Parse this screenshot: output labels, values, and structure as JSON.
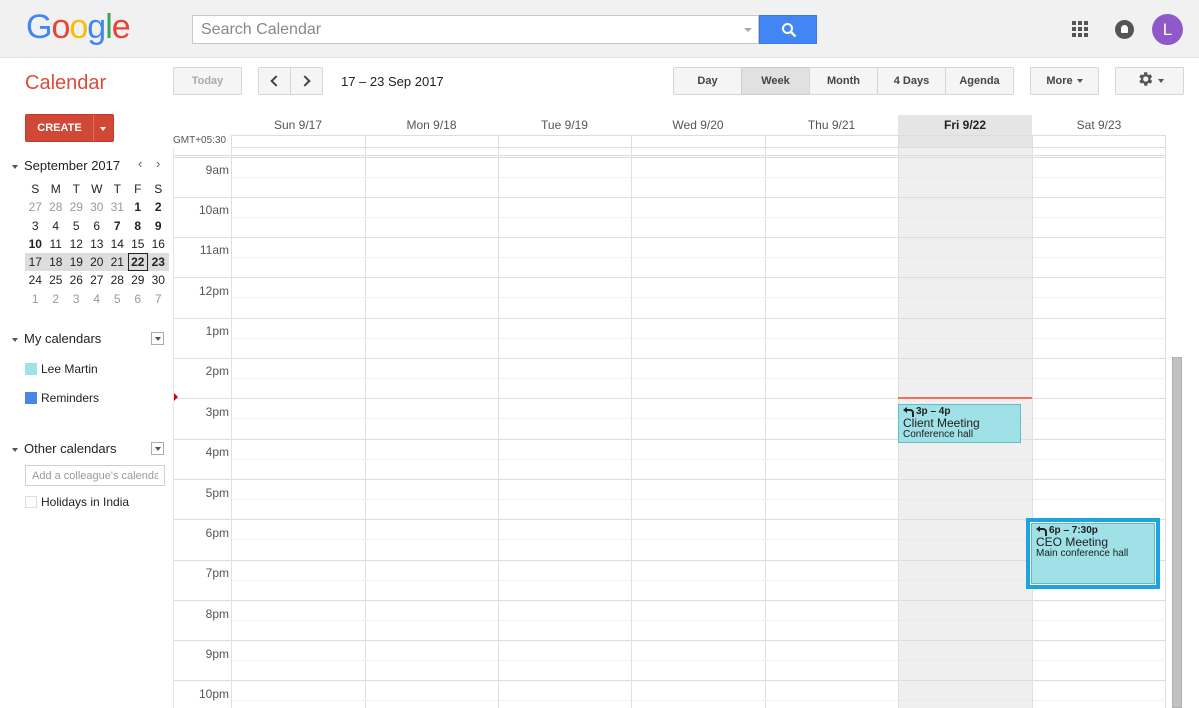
{
  "header": {
    "logo_text": "Google",
    "search_placeholder": "Search Calendar",
    "avatar_initial": "L"
  },
  "toolbar": {
    "app_name": "Calendar",
    "today_label": "Today",
    "date_range": "17 – 23 Sep 2017",
    "views": [
      "Day",
      "Week",
      "Month",
      "4 Days",
      "Agenda"
    ],
    "active_view": "Week",
    "more_label": "More"
  },
  "sidebar": {
    "create_label": "CREATE",
    "mini_calendar": {
      "title": "September 2017",
      "weekdays": [
        "S",
        "M",
        "T",
        "W",
        "T",
        "F",
        "S"
      ],
      "weeks": [
        [
          "27",
          "28",
          "29",
          "30",
          "31",
          "1",
          "2"
        ],
        [
          "3",
          "4",
          "5",
          "6",
          "7",
          "8",
          "9"
        ],
        [
          "10",
          "11",
          "12",
          "13",
          "14",
          "15",
          "16"
        ],
        [
          "17",
          "18",
          "19",
          "20",
          "21",
          "22",
          "23"
        ],
        [
          "24",
          "25",
          "26",
          "27",
          "28",
          "29",
          "30"
        ],
        [
          "1",
          "2",
          "3",
          "4",
          "5",
          "6",
          "7"
        ]
      ],
      "today": "22"
    },
    "my_calendars": {
      "title": "My calendars",
      "items": [
        {
          "label": "Lee Martin",
          "color": "#9fe1e7"
        },
        {
          "label": "Reminders",
          "color": "#4986e7"
        }
      ]
    },
    "other_calendars": {
      "title": "Other calendars",
      "input_placeholder": "Add a colleague's calendar",
      "items": [
        {
          "label": "Holidays in India",
          "color": "#ffffff"
        }
      ]
    }
  },
  "grid": {
    "timezone": "GMT+05:30",
    "days": [
      "Sun 9/17",
      "Mon 9/18",
      "Tue 9/19",
      "Wed 9/20",
      "Thu 9/21",
      "Fri 9/22",
      "Sat 9/23"
    ],
    "today_index": 5,
    "hours": [
      "9am",
      "10am",
      "11am",
      "12pm",
      "1pm",
      "2pm",
      "3pm",
      "4pm",
      "5pm",
      "6pm",
      "7pm",
      "8pm",
      "9pm",
      "10pm"
    ]
  },
  "events": [
    {
      "time": "3p – 4p",
      "title": "Client Meeting",
      "location": "Conference hall",
      "day": "Fri 9/22"
    },
    {
      "time": "6p – 7:30p",
      "title": "CEO Meeting",
      "location": "Main conference hall",
      "day": "Sat 9/23"
    }
  ],
  "colors": {
    "brand_red": "#dd4b39",
    "create_button": "#d14836",
    "search_blue": "#4285f4",
    "event_fill": "#9fe1e7",
    "selection_border": "#1ca4e0",
    "now_line": "#f0715c",
    "avatar": "#8e59c9"
  }
}
